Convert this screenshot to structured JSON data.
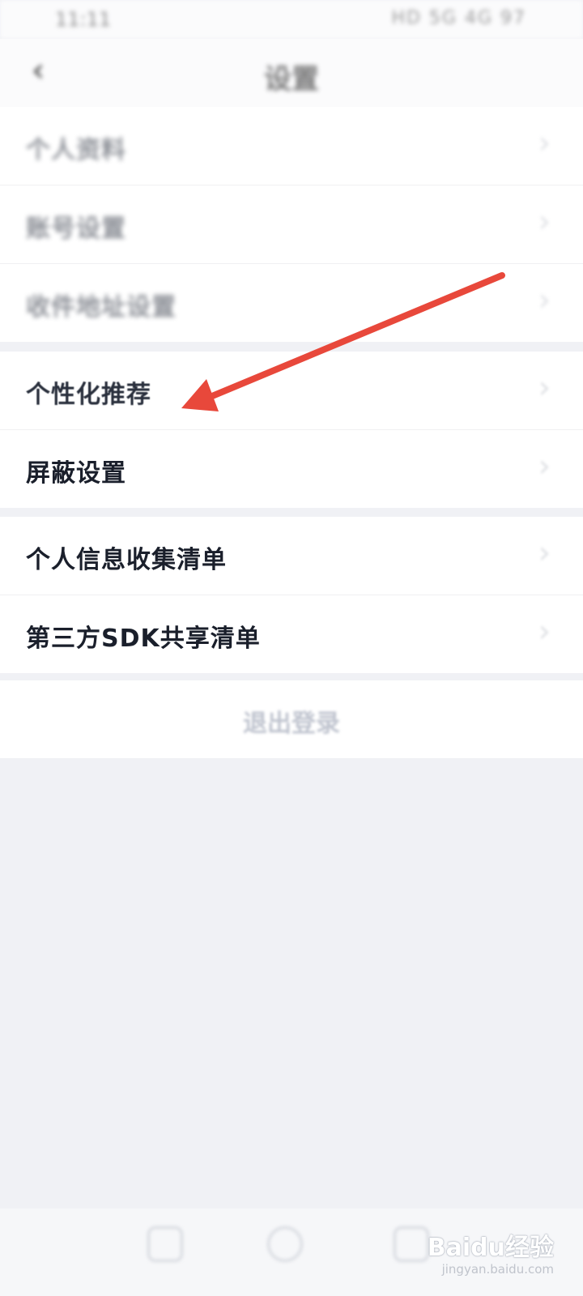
{
  "status_bar": {
    "time": "11:11",
    "icons": "HD 5G 4G 97"
  },
  "header": {
    "title": "设置"
  },
  "groups": [
    {
      "items": [
        {
          "label": "个人资料"
        },
        {
          "label": "账号设置"
        },
        {
          "label": "收件地址设置"
        }
      ]
    },
    {
      "items": [
        {
          "label": "个性化推荐"
        },
        {
          "label": "屏蔽设置"
        }
      ]
    },
    {
      "items": [
        {
          "label": "个人信息收集清单"
        },
        {
          "label": "第三方SDK共享清单"
        }
      ]
    }
  ],
  "logout": {
    "label": "退出登录"
  },
  "annotation": {
    "arrow_color": "#e8483b"
  },
  "watermark": {
    "brand": "Baidu经验",
    "url": "jingyan.baidu.com"
  },
  "colors": {
    "background": "#f0f1f5",
    "card": "#ffffff",
    "text": "#1a1f2b"
  }
}
